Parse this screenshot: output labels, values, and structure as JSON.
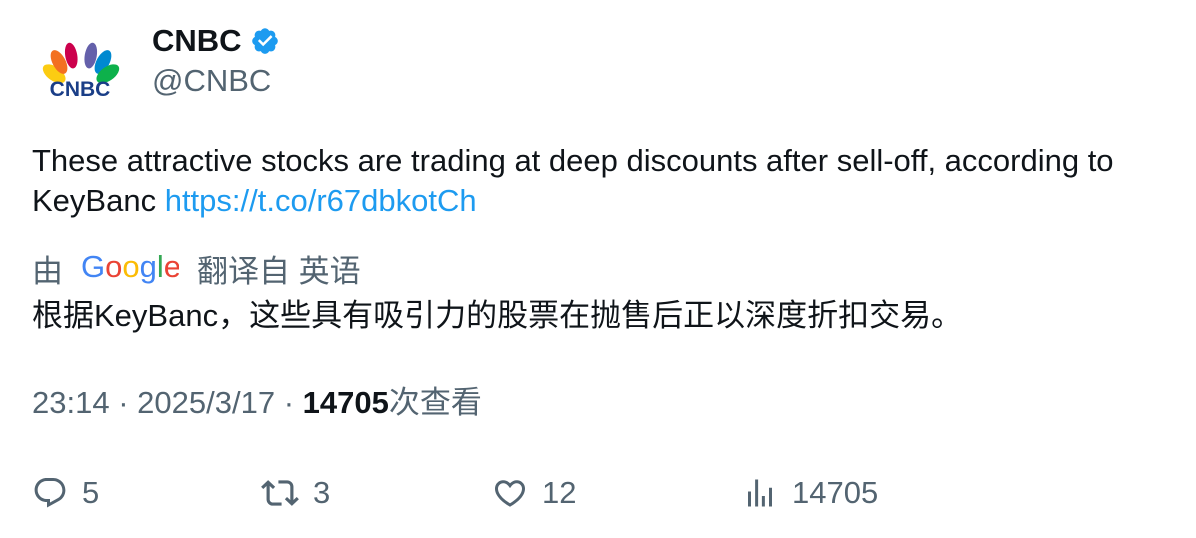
{
  "author": {
    "display_name": "CNBC",
    "handle": "@CNBC",
    "avatar_text": "CNBC",
    "verified": true
  },
  "tweet": {
    "text": "These attractive stocks are trading at deep discounts after sell-off, according to KeyBanc",
    "link": "https://t.co/r67dbkotCh"
  },
  "translation": {
    "by_label": "由",
    "provider": "Google",
    "from_label": "翻译自 英语",
    "text": "根据KeyBanc，这些具有吸引力的股票在抛售后正以深度折扣交易。"
  },
  "meta": {
    "time": "23:14",
    "date": "2025/3/17",
    "separator": "·",
    "views": "14705",
    "views_label": "次查看"
  },
  "actions": {
    "replies": "5",
    "retweets": "3",
    "likes": "12",
    "views": "14705"
  },
  "colors": {
    "link": "#1d9bf0",
    "secondary_text": "#536471",
    "primary_text": "#0f1419",
    "verified_badge": "#1d9bf0"
  },
  "icons": [
    "verified-badge-icon",
    "reply-icon",
    "retweet-icon",
    "like-icon",
    "views-icon"
  ]
}
